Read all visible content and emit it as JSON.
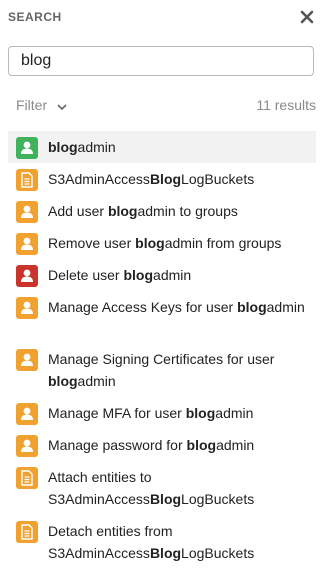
{
  "header": {
    "title": "SEARCH",
    "close_icon": "close-icon"
  },
  "search": {
    "value": "blog",
    "placeholder": ""
  },
  "filter": {
    "label": "Filter",
    "results_count": "11 results"
  },
  "colors": {
    "user": "#f0a12f",
    "file": "#f0a12f",
    "green": "#3fb25b",
    "red": "#c9352b"
  },
  "results": [
    {
      "icon": "user-icon",
      "color": "green",
      "parts": [
        "",
        "blog",
        "admin"
      ],
      "selected": true
    },
    {
      "icon": "file-icon",
      "color": "file",
      "parts": [
        "S3AdminAccess",
        "Blog",
        "LogBuckets"
      ]
    },
    {
      "icon": "user-icon",
      "color": "user",
      "parts": [
        "Add user ",
        "blog",
        "admin to groups"
      ]
    },
    {
      "icon": "user-icon",
      "color": "user",
      "parts": [
        "Remove user ",
        "blog",
        "admin from groups"
      ]
    },
    {
      "icon": "user-icon",
      "color": "red",
      "parts": [
        "Delete user ",
        "blog",
        "admin"
      ]
    },
    {
      "icon": "user-icon",
      "color": "user",
      "parts": [
        "Manage Access Keys for user ",
        "blog",
        "admin"
      ]
    },
    {
      "icon": "user-icon",
      "color": "user",
      "parts": [
        "Manage Signing Certificates for user ",
        "blog",
        "admin"
      ]
    },
    {
      "icon": "user-icon",
      "color": "user",
      "parts": [
        "Manage MFA for user ",
        "blog",
        "admin"
      ]
    },
    {
      "icon": "user-icon",
      "color": "user",
      "parts": [
        "Manage password for ",
        "blog",
        "admin"
      ]
    },
    {
      "icon": "file-icon",
      "color": "file",
      "parts": [
        "Attach entities to S3AdminAccess",
        "Blog",
        "LogBuckets"
      ]
    },
    {
      "icon": "file-icon",
      "color": "file",
      "parts": [
        "Detach entities from S3AdminAccess",
        "Blog",
        "LogBuckets"
      ]
    }
  ]
}
